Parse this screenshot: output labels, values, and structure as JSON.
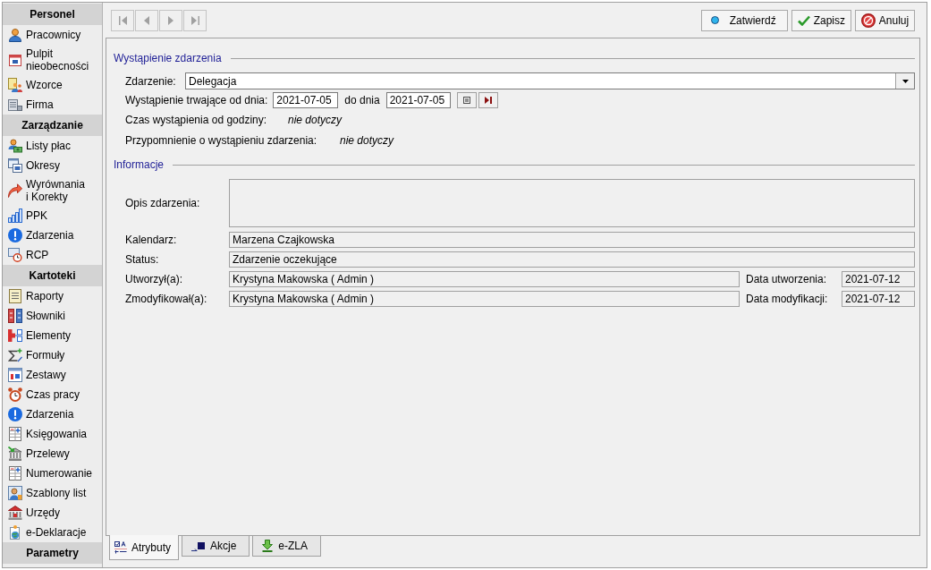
{
  "sidebar": {
    "groups": [
      {
        "title": "Personel",
        "items": [
          "Pracownicy",
          "Pulpit nieobecności",
          "Wzorce",
          "Firma"
        ]
      },
      {
        "title": "Zarządzanie",
        "items": [
          "Listy płac",
          "Okresy",
          "Wyrównania i Korekty",
          "PPK",
          "Zdarzenia",
          "RCP"
        ]
      },
      {
        "title": "Kartoteki",
        "items": [
          "Raporty",
          "Słowniki",
          "Elementy",
          "Formuły",
          "Zestawy",
          "Czas pracy",
          "Zdarzenia",
          "Księgowania",
          "Przelewy",
          "Numerowanie",
          "Szablony list",
          "Urzędy",
          "e-Deklaracje"
        ]
      },
      {
        "title": "Parametry"
      }
    ]
  },
  "toolbar": {
    "navigation": {
      "disabled": true
    },
    "buttons": [
      "Zatwierdź",
      "Zapisz",
      "Anuluj"
    ]
  },
  "form": {
    "occurrence": {
      "title": "Wystąpienie zdarzenia",
      "event": {
        "label": "Zdarzenie:",
        "value": "Delegacja"
      },
      "duration": {
        "label": "Wystąpienie trwające od dnia:",
        "from": "2021-07-05",
        "to_label": "do dnia",
        "to": "2021-07-05"
      },
      "time": {
        "label": "Czas wystąpienia od godziny:",
        "value": "nie dotyczy"
      },
      "reminder": {
        "label": "Przypomnienie o wystąpieniu zdarzenia:",
        "value": "nie dotyczy"
      }
    },
    "information": {
      "title": "Informacje",
      "description": {
        "label": "Opis zdarzenia:"
      },
      "calendar": {
        "label": "Kalendarz:",
        "value": "Marzena Czajkowska"
      },
      "status": {
        "label": "Status:",
        "value": "Zdarzenie oczekujące"
      },
      "created": {
        "label": "Utworzył(a):",
        "value": "Krystyna Makowska ( Admin )",
        "date_label": "Data utworzenia:",
        "date": "2021-07-12"
      },
      "modified": {
        "label": "Zmodyfikował(a):",
        "value": "Krystyna Makowska ( Admin )",
        "date_label": "Data modyfikacji:",
        "date": "2021-07-12"
      }
    }
  },
  "tabs": [
    {
      "label": "Atrybuty",
      "selected": true
    },
    {
      "label": "Akcje",
      "selected": false
    },
    {
      "label": "e-ZLA",
      "selected": false
    }
  ]
}
